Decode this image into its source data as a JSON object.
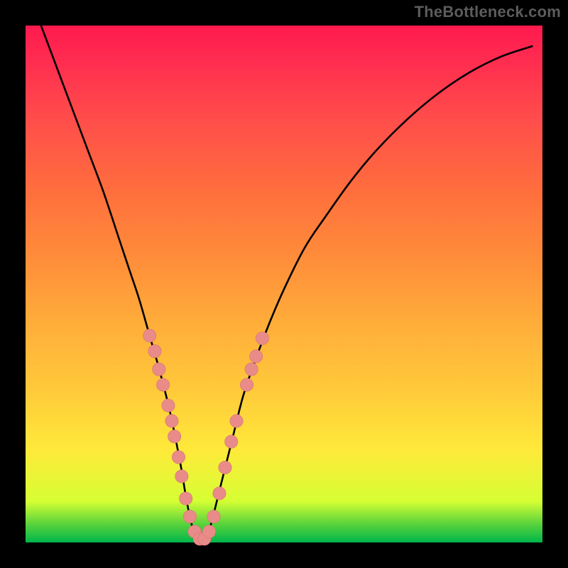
{
  "watermark": "TheBottleneck.com",
  "chart_data": {
    "type": "line",
    "title": "",
    "xlabel": "",
    "ylabel": "",
    "xlim": [
      0,
      100
    ],
    "ylim": [
      0,
      100
    ],
    "grid": false,
    "legend": false,
    "series": [
      {
        "name": "bottleneck-curve",
        "x": [
          3,
          6,
          9,
          12,
          15,
          18,
          20,
          22,
          24,
          26,
          28,
          30,
          31,
          32,
          33,
          34,
          35,
          36,
          38,
          40,
          42,
          44,
          47,
          50,
          54,
          58,
          63,
          68,
          74,
          80,
          86,
          92,
          98
        ],
        "y": [
          100,
          92,
          84,
          76,
          68,
          59,
          53,
          47,
          40,
          33,
          25,
          15,
          9,
          4,
          1,
          0,
          1,
          4,
          12,
          20,
          28,
          34,
          42,
          49,
          57,
          63,
          70,
          76,
          82,
          87,
          91,
          94,
          96
        ]
      }
    ],
    "highlight_points": {
      "name": "dots",
      "points": [
        {
          "x": 24.0,
          "y": 40.0
        },
        {
          "x": 25.0,
          "y": 37.0
        },
        {
          "x": 25.8,
          "y": 33.5
        },
        {
          "x": 26.6,
          "y": 30.5
        },
        {
          "x": 27.6,
          "y": 26.5
        },
        {
          "x": 28.3,
          "y": 23.5
        },
        {
          "x": 28.8,
          "y": 20.5
        },
        {
          "x": 29.6,
          "y": 16.5
        },
        {
          "x": 30.2,
          "y": 12.8
        },
        {
          "x": 31.0,
          "y": 8.5
        },
        {
          "x": 31.8,
          "y": 5.0
        },
        {
          "x": 32.7,
          "y": 2.1
        },
        {
          "x": 33.7,
          "y": 0.7
        },
        {
          "x": 34.6,
          "y": 0.7
        },
        {
          "x": 35.5,
          "y": 2.1
        },
        {
          "x": 36.4,
          "y": 5.0
        },
        {
          "x": 37.5,
          "y": 9.5
        },
        {
          "x": 38.6,
          "y": 14.5
        },
        {
          "x": 39.8,
          "y": 19.5
        },
        {
          "x": 40.8,
          "y": 23.5
        },
        {
          "x": 42.8,
          "y": 30.5
        },
        {
          "x": 43.7,
          "y": 33.5
        },
        {
          "x": 44.6,
          "y": 36.0
        },
        {
          "x": 45.8,
          "y": 39.5
        }
      ]
    },
    "gradient_stops": [
      {
        "pos": 0,
        "color": "#00b64a"
      },
      {
        "pos": 3.5,
        "color": "#58d23c"
      },
      {
        "pos": 8,
        "color": "#d6ff33"
      },
      {
        "pos": 18,
        "color": "#ffe93a"
      },
      {
        "pos": 30,
        "color": "#ffc83a"
      },
      {
        "pos": 42,
        "color": "#ffae3a"
      },
      {
        "pos": 55,
        "color": "#ff8d3a"
      },
      {
        "pos": 68,
        "color": "#ff6e3d"
      },
      {
        "pos": 82,
        "color": "#ff4d4b"
      },
      {
        "pos": 94,
        "color": "#ff2a50"
      },
      {
        "pos": 100,
        "color": "#ff1a4e"
      }
    ]
  }
}
